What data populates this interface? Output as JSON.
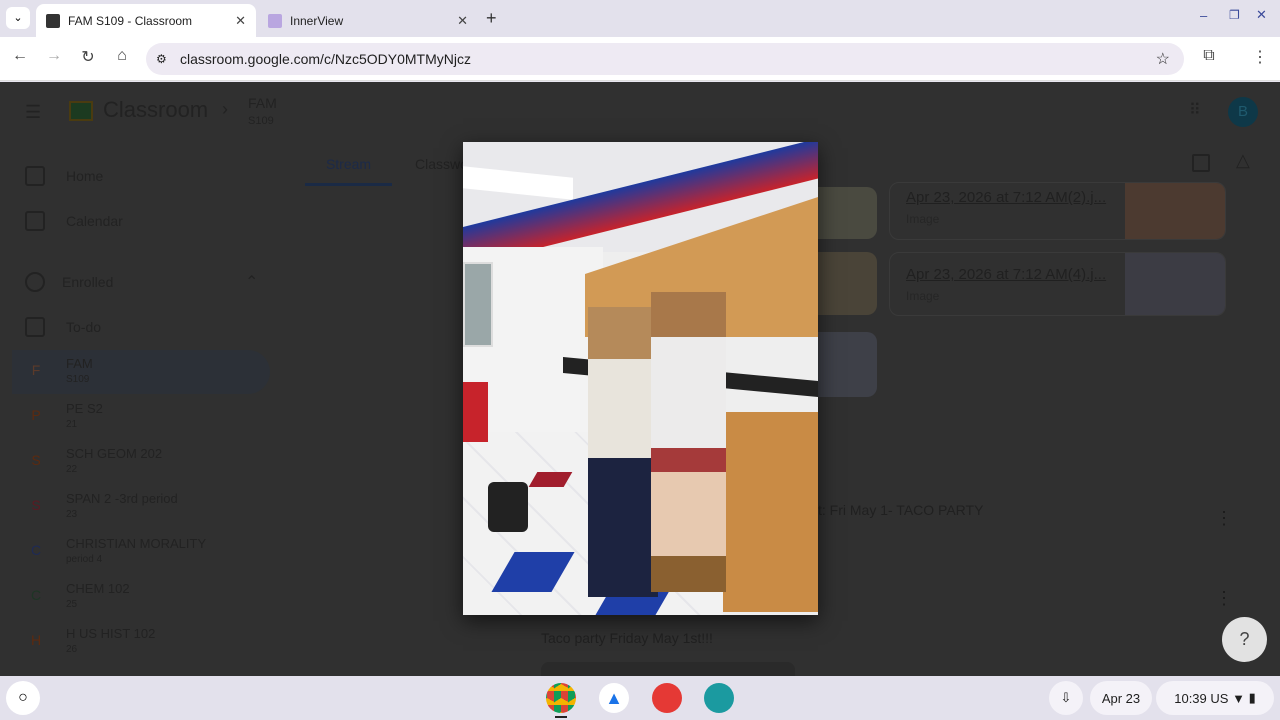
{
  "browser": {
    "tabs": [
      {
        "title": "FAM S109 - Classroom",
        "active": true
      },
      {
        "title": "InnerView",
        "active": false
      }
    ],
    "url": "classroom.google.com/c/Nzc5ODY0MTMyNjcz"
  },
  "header": {
    "app_name": "Classroom",
    "course": "FAM",
    "section": "S109",
    "avatar_letter": "B"
  },
  "tabs": [
    "Stream",
    "Classwork"
  ],
  "sidebar": {
    "home": "Home",
    "calendar": "Calendar",
    "enrolled": "Enrolled",
    "todo": "To-do",
    "courses": [
      {
        "letter": "F",
        "name": "FAM",
        "sub": "S109",
        "color": "#5b3a2a"
      },
      {
        "letter": "P",
        "name": "PE S2",
        "sub": "21",
        "color": "#5b2a10"
      },
      {
        "letter": "S",
        "name": "SCH GEOM 202",
        "sub": "22",
        "color": "#5b2a10"
      },
      {
        "letter": "S",
        "name": "SPAN 2 -3rd period",
        "sub": "23",
        "color": "#5a1a22"
      },
      {
        "letter": "C",
        "name": "CHRISTIAN MORALITY",
        "sub": "period 4",
        "color": "#1e2a55"
      },
      {
        "letter": "C",
        "name": "CHEM 102",
        "sub": "25",
        "color": "#1e3525"
      },
      {
        "letter": "H",
        "name": "H US HIST 102",
        "sub": "26",
        "color": "#5b2a10"
      }
    ]
  },
  "stream": {
    "attachments": [
      {
        "title": "Apr 23, 2026 at 7:12 AM(2).j...",
        "type": "Image"
      },
      {
        "title": "Apr 23, 2026 at 7:12 AM(4).j...",
        "type": "Image"
      }
    ],
    "post_title_fragment": "t: Fri May 1- TACO PARTY",
    "post_text": "Taco party Friday May 1st!!!"
  },
  "shelf": {
    "date": "Apr 23",
    "time": "10:39",
    "locale": "US"
  }
}
